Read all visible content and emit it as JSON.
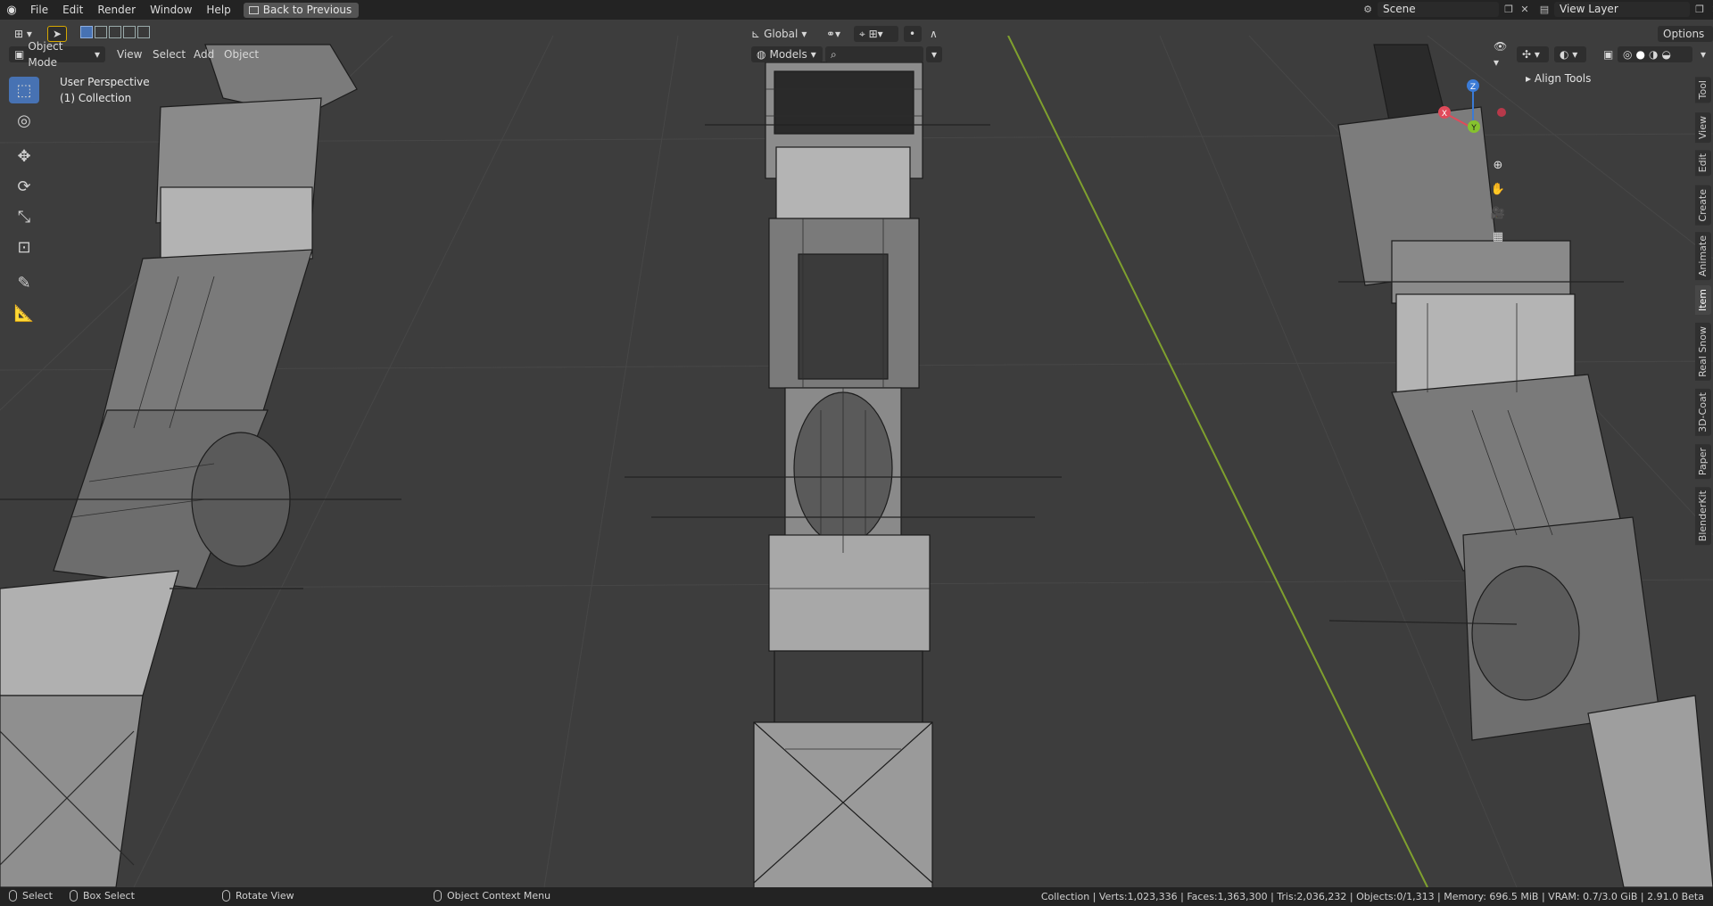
{
  "menu": {
    "items": [
      "File",
      "Edit",
      "Render",
      "Window",
      "Help"
    ],
    "back_label": "Back to Previous"
  },
  "scene": {
    "scene_name": "Scene",
    "view_layer": "View Layer"
  },
  "viewport_header": {
    "mode": "Object Mode",
    "menus": [
      "View",
      "Select",
      "Add",
      "Object"
    ],
    "orientation": "Global",
    "collection_filter": "Models",
    "options_label": "Options"
  },
  "overlay": {
    "perspective": "User Perspective",
    "collection": "(1) Collection"
  },
  "sidebar": {
    "panel_title": "Align Tools",
    "tabs": [
      "Tool",
      "View",
      "Edit",
      "Create",
      "Animate",
      "Item",
      "Real Snow",
      "3D-Coat",
      "Paper",
      "BlenderKit"
    ],
    "active_tab": "Item"
  },
  "gizmo": {
    "x_label": "X",
    "y_label": "Y",
    "z_label": "Z"
  },
  "statusbar": {
    "select": "Select",
    "box_select": "Box Select",
    "rotate_view": "Rotate View",
    "context_menu": "Object Context Menu",
    "stats": "Collection | Verts:1,023,336 | Faces:1,363,300 | Tris:2,036,232 | Objects:0/1,313 | Memory: 696.5 MiB | VRAM: 0.7/3.0 GiB | 2.91.0 Beta"
  }
}
